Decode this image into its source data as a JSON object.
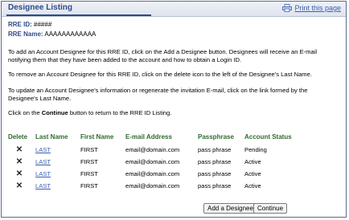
{
  "header": {
    "title": "Designee Listing",
    "print_label": "Print this page"
  },
  "rre": {
    "id_label": "RRE ID:",
    "id_value": "#####",
    "name_label": "RRE Name:",
    "name_value": "AAAAAAAAAAAA"
  },
  "instructions": {
    "p1": "To add an Account Designee for this RRE ID, click on the Add a Designee button. Designees will receive an E-mail notifying them that they have been added to the account and how to obtain a Login ID.",
    "p2": "To remove an Account Designee for this RRE ID, click on the delete icon to the left of the Designee's Last Name.",
    "p3": "To update an Account Designee's information or regenerate the invitation E-mail, click on the link formed by the Designee's Last Name.",
    "p4_pre": "Click on the ",
    "p4_bold": "Continue",
    "p4_post": " button to return to the RRE ID Listing."
  },
  "table": {
    "headers": [
      "Delete",
      "Last Name",
      "First Name",
      "E-mail Address",
      "Passphrase",
      "Account Status"
    ],
    "rows": [
      {
        "last": "LAST",
        "first": "FIRST",
        "email": "email@domain.com",
        "pass": "pass phrase",
        "status": "Pending"
      },
      {
        "last": "LAST",
        "first": "FIRST",
        "email": "email@domain.com",
        "pass": "pass phrase",
        "status": "Active"
      },
      {
        "last": "LAST",
        "first": "FIRST",
        "email": "email@domain.com",
        "pass": "pass phrase",
        "status": "Active"
      },
      {
        "last": "LAST",
        "first": "FIRST",
        "email": "email@domain.com",
        "pass": "pass phrase",
        "status": "Active"
      }
    ],
    "delete_glyph": "✕"
  },
  "buttons": {
    "add": "Add a Designee",
    "continue": "Continue"
  },
  "colors": {
    "title": "#2f4a86",
    "link": "#3a5fb0",
    "table_header": "#2f6b2f"
  }
}
